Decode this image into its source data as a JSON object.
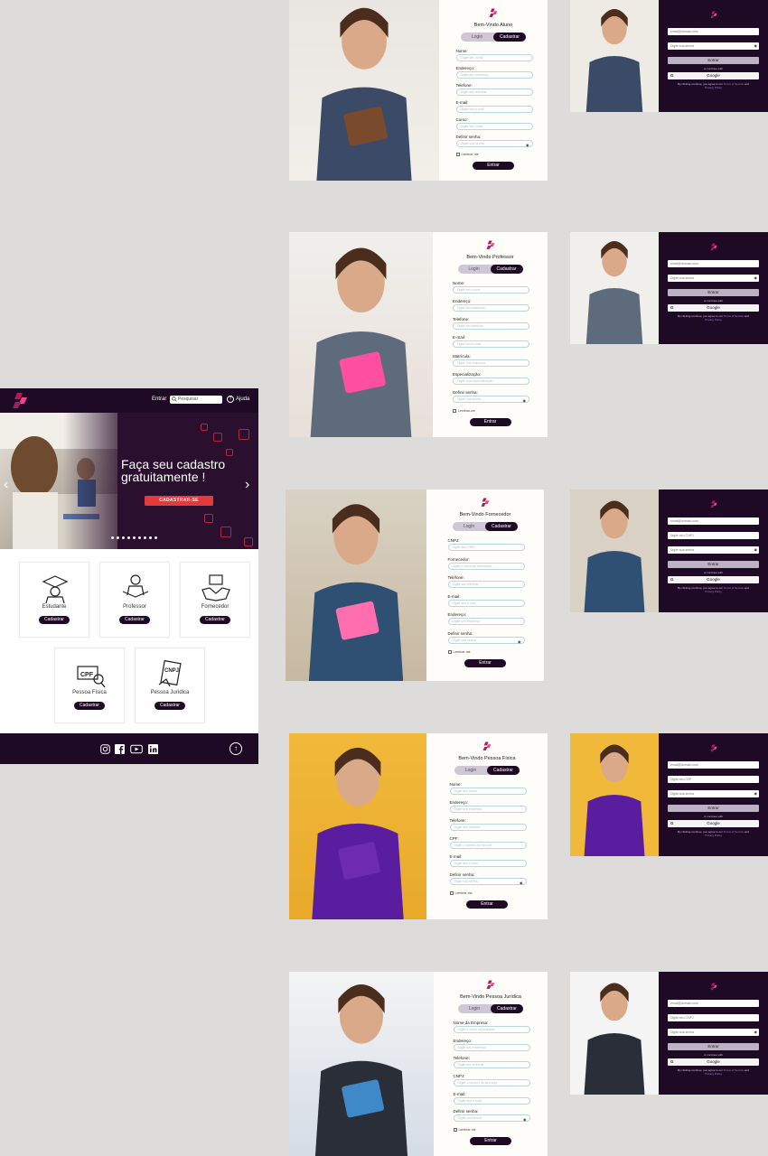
{
  "colors": {
    "brand_dark": "#1f0a26",
    "accent_red": "#e63a3a",
    "logo_magenta": "#c4125a"
  },
  "landing": {
    "nav": {
      "enter": "Entrar",
      "search_placeholder": "Pesquisar",
      "help": "Ajuda"
    },
    "hero": {
      "title_line1": "Faça seu cadastro",
      "title_line2": "gratuitamente !",
      "cta": "CADASTRAR-SE",
      "prev": "‹",
      "next": "›"
    },
    "categories": [
      {
        "name": "Estudante",
        "button": "Cadastrar",
        "icon": "graduation-icon"
      },
      {
        "name": "Professor",
        "button": "Cadastrar",
        "icon": "teacher-icon"
      },
      {
        "name": "Fornecedor",
        "button": "Cadastrar",
        "icon": "handshake-icon"
      },
      {
        "name": "Pessoa Física",
        "button": "Cadastrar",
        "icon": "cpf-card-icon"
      },
      {
        "name": "Pessoa Jurídica",
        "button": "Cadastrar",
        "icon": "cnpj-doc-icon"
      }
    ],
    "footer": {
      "socials": [
        "instagram-icon",
        "facebook-icon",
        "youtube-icon",
        "linkedin-icon"
      ],
      "up": "↑"
    }
  },
  "forms": [
    {
      "title": "Bem-Vindo Aluno",
      "login": "Login",
      "register": "Cadastrar",
      "fields": [
        {
          "label": "Nome:",
          "placeholder": "Digite seu nome"
        },
        {
          "label": "Endereço:",
          "placeholder": "Digite seu endereço"
        },
        {
          "label": "Telefone:",
          "placeholder": "Digite seu telefone"
        },
        {
          "label": "E-mail:",
          "placeholder": "Digite seu e-mail"
        },
        {
          "label": "Curso:",
          "placeholder": "Digite seu curso"
        },
        {
          "label": "Definir senha:",
          "placeholder": "Digite sua senha"
        }
      ],
      "remember": "Lembrar-me",
      "submit": "Entrar"
    },
    {
      "title": "Bem-Vindo Professor",
      "login": "Login",
      "register": "Cadastrar",
      "fields": [
        {
          "label": "Nome:",
          "placeholder": "Digite seu nome"
        },
        {
          "label": "Endereço:",
          "placeholder": "Digite seu endereço"
        },
        {
          "label": "Telefone:",
          "placeholder": "Digite seu telefone"
        },
        {
          "label": "E-mail:",
          "placeholder": "Digite seu e-mail"
        },
        {
          "label": "Matrícula:",
          "placeholder": "Digite sua matrícula"
        },
        {
          "label": "Especialização:",
          "placeholder": "Digite sua especialização"
        },
        {
          "label": "Definir senha:",
          "placeholder": "Digite sua senha"
        }
      ],
      "remember": "Lembrar-me",
      "submit": "Entrar"
    },
    {
      "title": "Bem-Vindo Fornecedor",
      "login": "Login",
      "register": "Cadastrar",
      "fields": [
        {
          "label": "CNPJ:",
          "placeholder": "Digite seu CNPJ"
        },
        {
          "label": "Fornecedor:",
          "placeholder": "Digite o nome do fornecedor"
        },
        {
          "label": "Telefone:",
          "placeholder": "Digite seu telefone"
        },
        {
          "label": "E-mail:",
          "placeholder": "Digite seu e-mail"
        },
        {
          "label": "Endereço:",
          "placeholder": "Digite seu endereço"
        },
        {
          "label": "Definir senha:",
          "placeholder": "Digite sua senha"
        }
      ],
      "remember": "Lembrar-me",
      "submit": "Entrar"
    },
    {
      "title": "Bem-Vindo Pessoa Física",
      "login": "Login",
      "register": "Cadastrar",
      "fields": [
        {
          "label": "Nome:",
          "placeholder": "Digite seu nome"
        },
        {
          "label": "Endereço:",
          "placeholder": "Digite seu endereço"
        },
        {
          "label": "Telefone:",
          "placeholder": "Digite seu telefone"
        },
        {
          "label": "CPF:",
          "placeholder": "Digite o número do seu cpf"
        },
        {
          "label": "E-mail:",
          "placeholder": "Digite seu e-mail"
        },
        {
          "label": "Definir senha:",
          "placeholder": "Digite sua senha"
        }
      ],
      "remember": "Lembrar-me",
      "submit": "Entrar"
    },
    {
      "title": "Bem-Vindo Pessoa Jurídica",
      "login": "Login",
      "register": "Cadastrar",
      "fields": [
        {
          "label": "Nome da Empresa:",
          "placeholder": "Digite o nome da empresa"
        },
        {
          "label": "Endereço:",
          "placeholder": "Digite seu endereço"
        },
        {
          "label": "Telefone:",
          "placeholder": "Digite seu telefone"
        },
        {
          "label": "CNPJ:",
          "placeholder": "Digite o número do seu cnpj"
        },
        {
          "label": "E-mail:",
          "placeholder": "Digite seu e-mail"
        },
        {
          "label": "Definir senha:",
          "placeholder": "Digite sua senha"
        }
      ],
      "remember": "Lembrar-me",
      "submit": "Entrar"
    }
  ],
  "logins": [
    {
      "fields": [
        "email@domain.com",
        "Digite sua senha"
      ],
      "enter": "Entrar",
      "or": "or continue with",
      "google": "Google",
      "terms_pre": "By clicking continue, you agree to our",
      "terms_link": "Terms of Service",
      "terms_and": "and",
      "privacy": "Privacy Policy"
    },
    {
      "fields": [
        "email@domain.com",
        "Digite sua senha"
      ],
      "enter": "Entrar",
      "or": "or continue with",
      "google": "Google",
      "terms_pre": "By clicking continue, you agree to our",
      "terms_link": "Terms of Service",
      "terms_and": "and",
      "privacy": "Privacy Policy"
    },
    {
      "fields": [
        "email@domain.com",
        "Digite seu CNPJ",
        "Digite sua senha"
      ],
      "enter": "Entrar",
      "or": "or continue with",
      "google": "Google",
      "terms_pre": "By clicking continue, you agree to our",
      "terms_link": "Terms of Service",
      "terms_and": "and",
      "privacy": "Privacy Policy"
    },
    {
      "fields": [
        "email@domain.com",
        "Digite seu CPF",
        "Digite sua senha"
      ],
      "enter": "Entrar",
      "or": "or continue with",
      "google": "Google",
      "terms_pre": "By clicking continue, you agree to our",
      "terms_link": "Terms of Service",
      "terms_and": "and",
      "privacy": "Privacy Policy"
    },
    {
      "fields": [
        "email@domain.com",
        "Digite seu CNPJ",
        "Digite sua senha"
      ],
      "enter": "Entrar",
      "or": "or continue with",
      "google": "Google",
      "terms_pre": "By clicking continue, you agree to our",
      "terms_link": "Terms of Service",
      "terms_and": "and",
      "privacy": "Privacy Policy"
    }
  ]
}
